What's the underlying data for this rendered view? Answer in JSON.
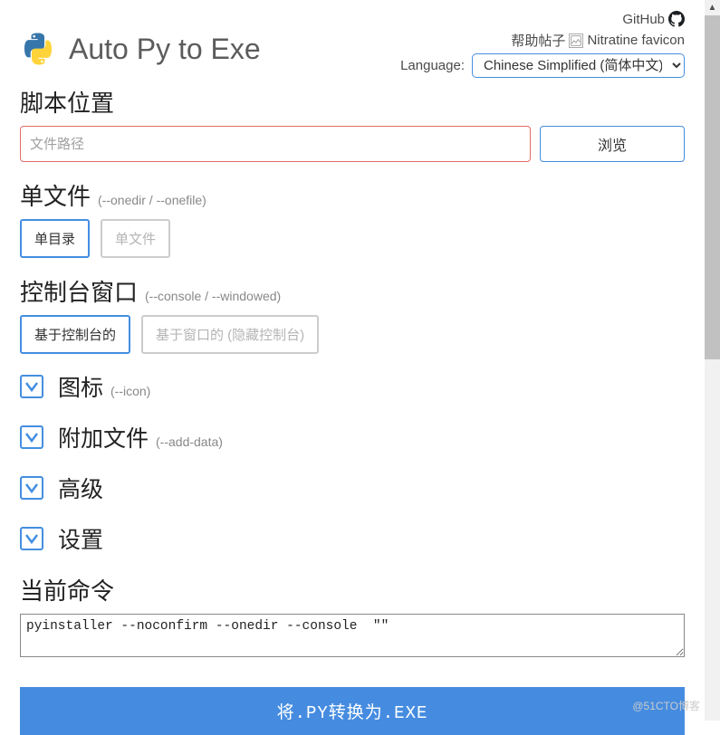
{
  "header": {
    "github_text": "GitHub",
    "help_text": "帮助帖子",
    "favicon_text": "Nitratine favicon",
    "language_label": "Language:",
    "language_value": "Chinese Simplified (简体中文)",
    "app_title": "Auto Py to Exe"
  },
  "script_location": {
    "title": "脚本位置",
    "placeholder": "文件路径",
    "browse_label": "浏览"
  },
  "onefile": {
    "title": "单文件",
    "hint": "(--onedir / --onefile)",
    "options": [
      "单目录",
      "单文件"
    ]
  },
  "console": {
    "title": "控制台窗口",
    "hint": "(--console / --windowed)",
    "options": [
      "基于控制台的",
      "基于窗口的 (隐藏控制台)"
    ]
  },
  "collapsibles": [
    {
      "label": "图标",
      "hint": "(--icon)"
    },
    {
      "label": "附加文件",
      "hint": "(--add-data)"
    },
    {
      "label": "高级",
      "hint": ""
    },
    {
      "label": "设置",
      "hint": ""
    }
  ],
  "command": {
    "title": "当前命令",
    "value": "pyinstaller --noconfirm --onedir --console  \"\""
  },
  "convert_button": "将.PY转换为.EXE",
  "watermark": "@51CTO博客"
}
